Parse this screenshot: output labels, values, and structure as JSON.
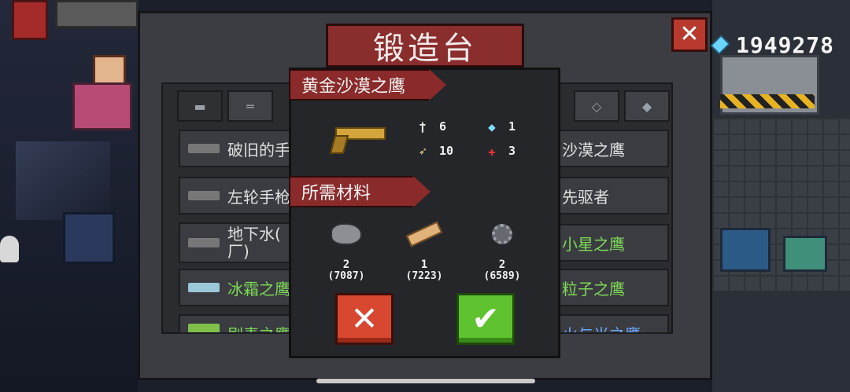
{
  "header": {
    "title": "锻造台",
    "gem_count": "1949278"
  },
  "tabs": [
    {
      "icon": "pistol-icon"
    },
    {
      "icon": "rifle-icon"
    },
    {
      "icon": "crosshair-icon"
    },
    {
      "icon": "shark-gun-icon"
    }
  ],
  "weapon_list": {
    "left": [
      {
        "label": "破旧的手",
        "rarity": "common"
      },
      {
        "label": "左轮手枪",
        "rarity": "common"
      },
      {
        "label": "地下水(",
        "label2": "厂)",
        "rarity": "common"
      },
      {
        "label": "冰霜之鹰",
        "rarity": "uncommon"
      },
      {
        "label": "剧毒之鹰",
        "rarity": "uncommon"
      }
    ],
    "right": [
      {
        "label": "沙漠之鹰",
        "rarity": "common"
      },
      {
        "label": "先驱者",
        "rarity": "common"
      },
      {
        "label": "小星之鹰",
        "rarity": "uncommon"
      },
      {
        "label": "粒子之鹰",
        "rarity": "uncommon"
      },
      {
        "label": "火与光之鹰",
        "rarity": "rare"
      }
    ]
  },
  "recipe": {
    "weapon_name": "黄金沙漠之鹰",
    "stats": {
      "damage": "6",
      "energy": "1",
      "ammo": "10",
      "crit": "3"
    },
    "materials_label": "所需材料",
    "materials": [
      {
        "icon": "ore-icon",
        "required": "2",
        "owned": "(7087)"
      },
      {
        "icon": "wood-plank-icon",
        "required": "1",
        "owned": "(7223)"
      },
      {
        "icon": "gear-part-icon",
        "required": "2",
        "owned": "(6589)"
      }
    ],
    "cancel_symbol": "✕",
    "confirm_symbol": "✔"
  },
  "close_symbol": "✕",
  "colors": {
    "banner": "#8a2d2d",
    "cancel": "#d8472f",
    "confirm": "#5fc22f",
    "uncommon_text": "#7ed957",
    "rare_text": "#6aa8ff"
  }
}
